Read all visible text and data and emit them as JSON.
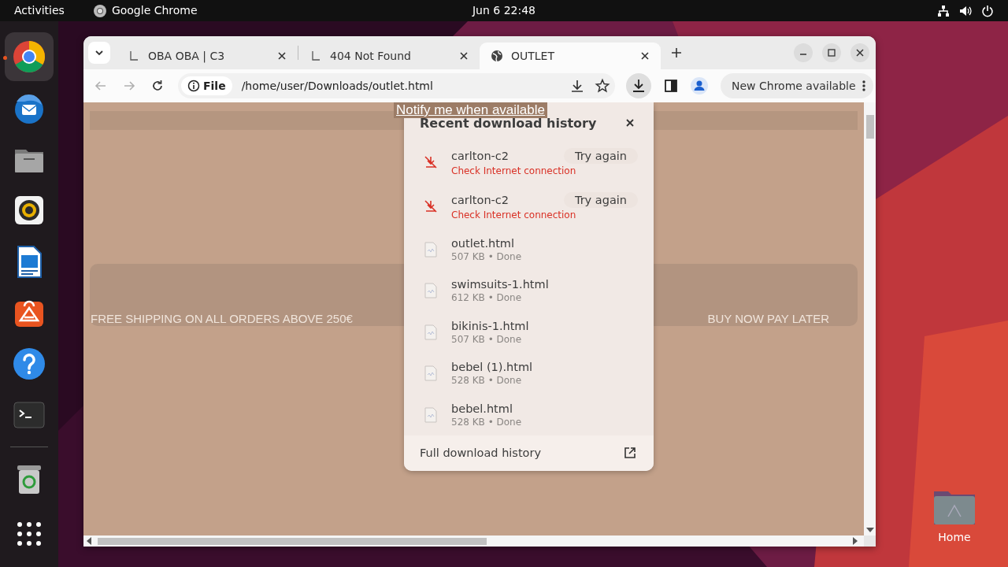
{
  "top_bar": {
    "activities": "Activities",
    "app": "Google Chrome",
    "clock": "Jun 6  22:48"
  },
  "dock": {
    "items": [
      {
        "kind": "chrome",
        "selected": true
      },
      {
        "kind": "mail",
        "selected": false
      },
      {
        "kind": "files",
        "selected": false
      },
      {
        "kind": "music",
        "selected": false
      },
      {
        "kind": "writer",
        "selected": false
      },
      {
        "kind": "store",
        "selected": false
      },
      {
        "kind": "help",
        "selected": false
      },
      {
        "kind": "terminal",
        "selected": false
      },
      {
        "kind": "trash",
        "selected": false
      },
      {
        "kind": "grid",
        "selected": false
      }
    ]
  },
  "desktop_icons": [
    {
      "label": "Home"
    }
  ],
  "browser": {
    "tabs": [
      {
        "title": "OBA OBA | C3",
        "kind": "loading",
        "selected": false
      },
      {
        "title": "404 Not Found",
        "kind": "loading",
        "selected": false
      },
      {
        "title": "OUTLET",
        "kind": "globe",
        "selected": true
      }
    ],
    "nav": {
      "back_disabled": true,
      "forward_disabled": true
    },
    "address": {
      "chip": "File",
      "url": "/home/user/Downloads/outlet.html"
    },
    "downloads_button": {
      "active": true
    },
    "update_button": "New Chrome available"
  },
  "page": {
    "notify_link": "Notify me when available",
    "banner_left": "FREE SHIPPING ON ALL ORDERS ABOVE 250€",
    "banner_right": "BUY NOW PAY LATER"
  },
  "downloads_panel": {
    "title": "Recent download history",
    "items": [
      {
        "kind": "failed",
        "name": "carlton-c2",
        "status": "Check Internet connection",
        "action": "Try again"
      },
      {
        "kind": "failed",
        "name": "carlton-c2",
        "status": "Check Internet connection",
        "action": "Try again"
      },
      {
        "kind": "done",
        "name": "outlet.html",
        "status": "507 KB • Done"
      },
      {
        "kind": "done",
        "name": "swimsuits-1.html",
        "status": "612 KB • Done"
      },
      {
        "kind": "done",
        "name": "bikinis-1.html",
        "status": "507 KB • Done"
      },
      {
        "kind": "done",
        "name": "bebel (1).html",
        "status": "528 KB • Done"
      },
      {
        "kind": "done",
        "name": "bebel.html",
        "status": "528 KB • Done"
      }
    ],
    "footer": "Full download history"
  }
}
